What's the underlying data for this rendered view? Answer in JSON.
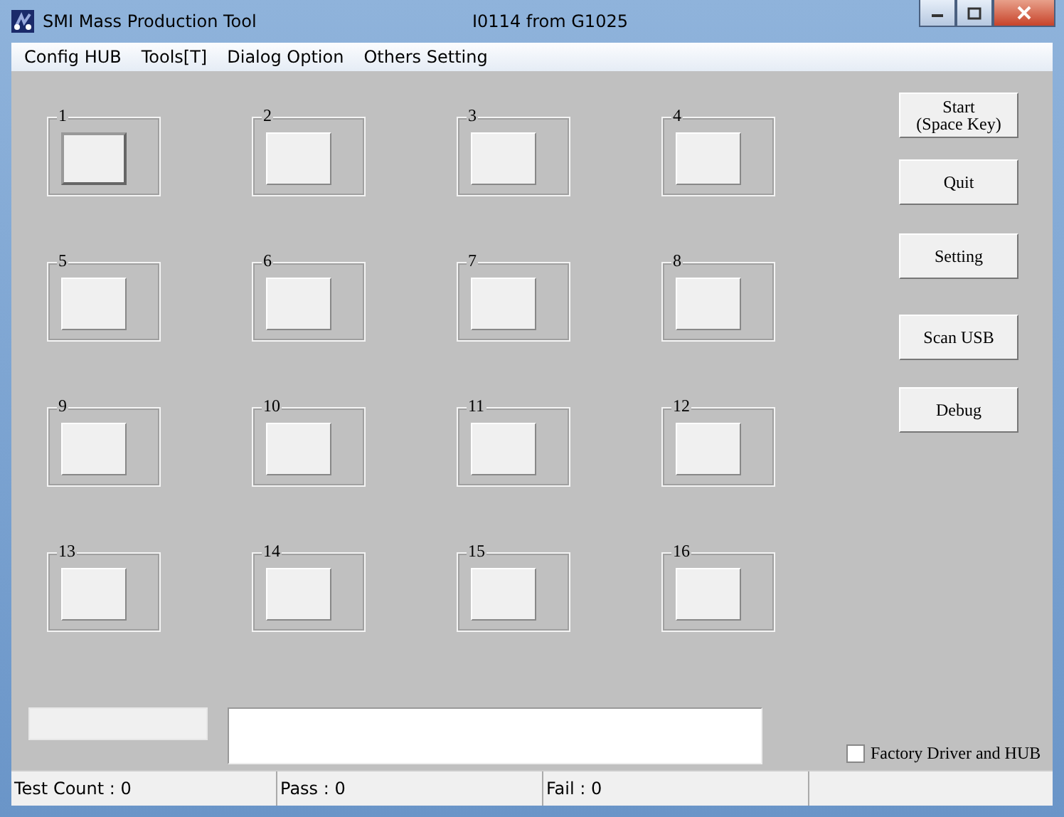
{
  "window": {
    "title": "SMI Mass Production Tool",
    "subtitle": "I0114 from G1025"
  },
  "menu": [
    "Config HUB",
    "Tools[T]",
    "Dialog Option",
    "Others Setting"
  ],
  "ports": [
    {
      "label": "1",
      "selected": true
    },
    {
      "label": "2",
      "selected": false
    },
    {
      "label": "3",
      "selected": false
    },
    {
      "label": "4",
      "selected": false
    },
    {
      "label": "5",
      "selected": false
    },
    {
      "label": "6",
      "selected": false
    },
    {
      "label": "7",
      "selected": false
    },
    {
      "label": "8",
      "selected": false
    },
    {
      "label": "9",
      "selected": false
    },
    {
      "label": "10",
      "selected": false
    },
    {
      "label": "11",
      "selected": false
    },
    {
      "label": "12",
      "selected": false
    },
    {
      "label": "13",
      "selected": false
    },
    {
      "label": "14",
      "selected": false
    },
    {
      "label": "15",
      "selected": false
    },
    {
      "label": "16",
      "selected": false
    }
  ],
  "buttons": [
    {
      "lines": [
        "Start",
        "(Space Key)"
      ]
    },
    {
      "lines": [
        "Quit"
      ]
    },
    {
      "lines": [
        "Setting"
      ]
    },
    {
      "lines": [
        "Scan USB"
      ]
    },
    {
      "lines": [
        "Debug"
      ]
    }
  ],
  "progress": {
    "level": 0
  },
  "factory_driver": {
    "label": "Factory Driver and HUB",
    "checked": false
  },
  "status_bar": [
    "Test Count : 0",
    "Pass : 0",
    "Fail : 0"
  ]
}
